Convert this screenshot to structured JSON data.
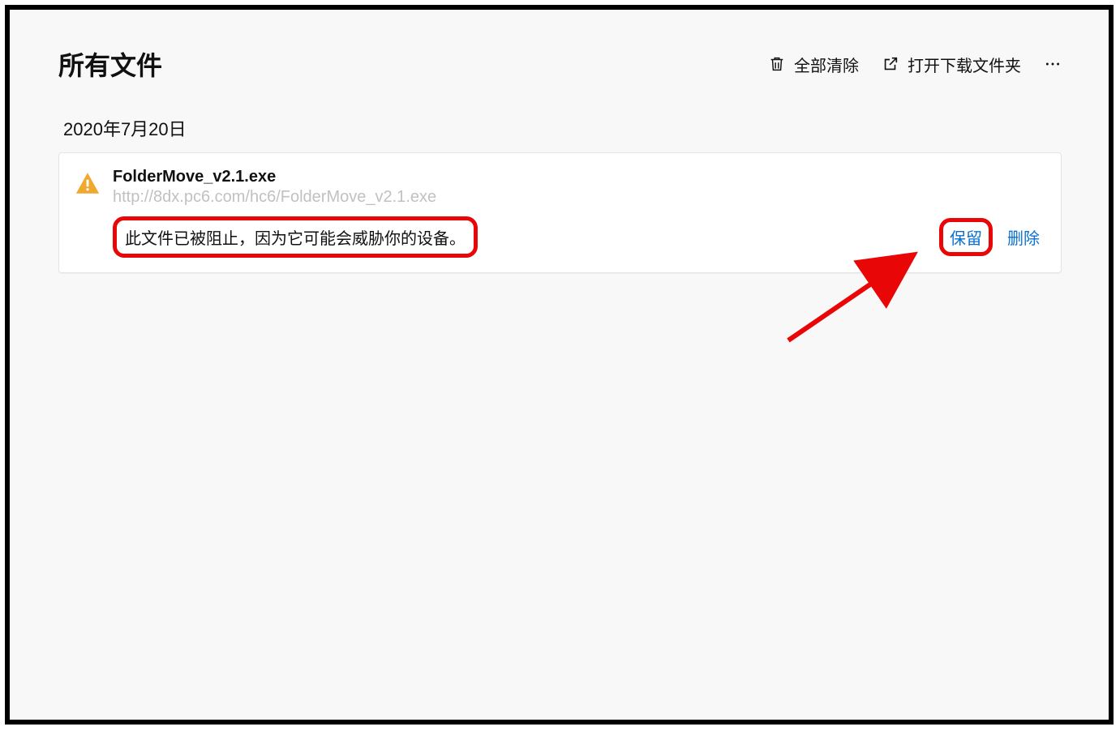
{
  "header": {
    "title": "所有文件",
    "clear_label": "全部清除",
    "open_folder_label": "打开下载文件夹"
  },
  "date_group": "2020年7月20日",
  "download": {
    "filename": "FolderMove_v2.1.exe",
    "url": "http://8dx.pc6.com/hc6/FolderMove_v2.1.exe",
    "blocked_message": "此文件已被阻止，因为它可能会威胁你的设备。",
    "keep_label": "保留",
    "delete_label": "删除"
  },
  "colors": {
    "highlight": "#e90606",
    "link": "#0a71d1",
    "warn": "#f0a930"
  }
}
